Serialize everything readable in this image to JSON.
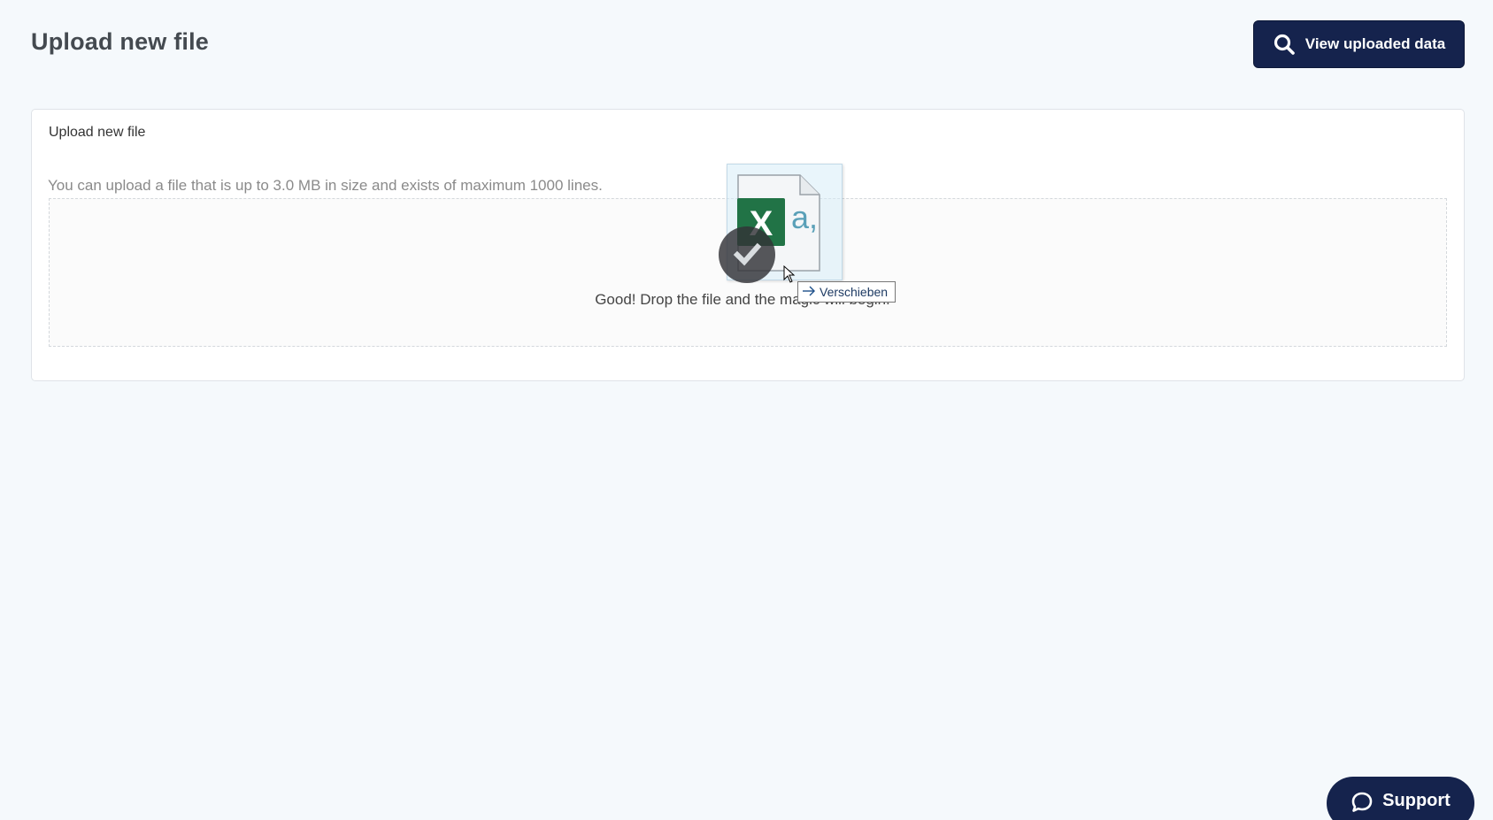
{
  "header": {
    "title": "Upload new file",
    "view_button_label": "View uploaded data",
    "view_button_icon": "search-icon"
  },
  "card": {
    "title": "Upload new file",
    "hint": "You can upload a file that is up to 3.0 MB in size and exists of maximum 1000 lines.",
    "dropzone_message": "Good! Drop the file and the magic will begin."
  },
  "drag": {
    "file_icon": "excel-file-icon",
    "excel_letter": "X",
    "doc_glyph": "a,",
    "tooltip_label": "Verschieben"
  },
  "support": {
    "label": "Support",
    "icon": "chat-bubble-icon"
  },
  "colors": {
    "primary": "#15234d",
    "background": "#f5f9fc",
    "excel_green": "#217346"
  }
}
